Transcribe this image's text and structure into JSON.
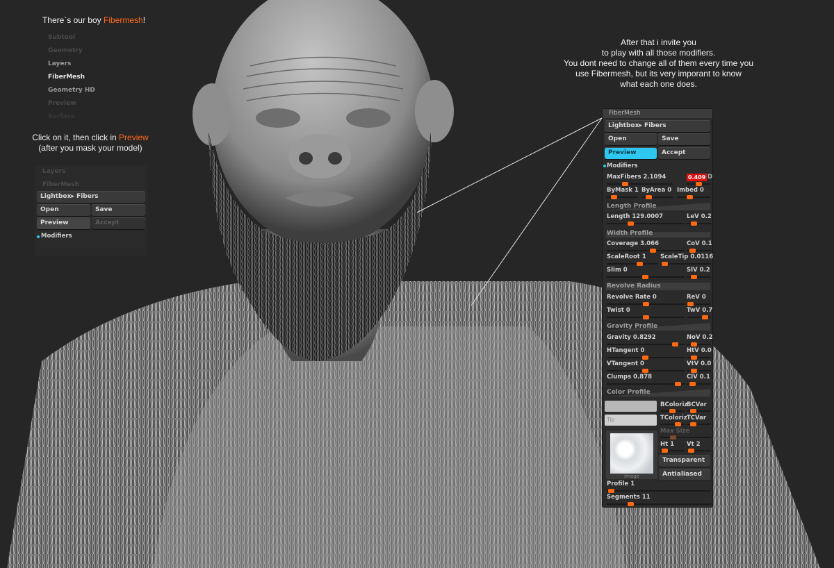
{
  "notes": {
    "top_prefix": "There`s our boy ",
    "top_accent": "Fibermesh",
    "top_suffix": "!",
    "click_prefix": "Click on it, then click in ",
    "click_accent": "Preview",
    "click_line2": "(after you mask your model)",
    "right_lines": [
      "After that i invite you",
      "to play with all those modifiers.",
      "You dont need to change all of them every time you",
      "use Fibermesh, but its very imporant to know",
      "what each one does."
    ]
  },
  "left_menu": [
    "Subtool",
    "Geometry",
    "Layers",
    "FiberMesh",
    "Geometry HD",
    "Preview",
    "Surface"
  ],
  "left_panel": {
    "dim_items": [
      "Layers",
      "FiberMesh"
    ],
    "lightbox": "Lightbox▸ Fibers",
    "open": "Open",
    "save": "Save",
    "preview": "Preview",
    "accept": "Accept",
    "modifiers": "Modifiers",
    "cut_off": "Modifiers"
  },
  "fibermesh": {
    "title": "FiberMesh",
    "lightbox": "Lightbox▸ Fibers",
    "open": "Open",
    "save": "Save",
    "preview": "Preview",
    "accept": "Accept",
    "modifiers": "Modifiers",
    "maxfibers_label": "MaxFibers",
    "maxfibers_value": "2.1094",
    "red_value": "0.409",
    "red_suffix": "D",
    "bymask": "ByMask 1",
    "byarea": "ByArea 0",
    "imbed": "Imbed 0",
    "length_profile": "Length Profile",
    "length": "Length 129.0007",
    "lev": "LeV 0.2",
    "width_profile": "Width Profile",
    "coverage": "Coverage 3.066",
    "cov": "CoV 0.1",
    "scaleroot": "ScaleRoot 1",
    "scaletip": "ScaleTip 0.0116",
    "slim": "Slim 0",
    "slv": "SlV 0.2",
    "revolve_radius": "Revolve Radius",
    "revolve_rate": "Revolve Rate 0",
    "rev": "ReV 0",
    "twist": "Twist 0",
    "twv": "TwV 0.7",
    "gravity_profile": "Gravity Profile",
    "gravity": "Gravity 0.8292",
    "nov": "NoV 0.2",
    "htangent": "HTangent 0",
    "htv": "HtV 0.0",
    "vtangent": "VTangent 0",
    "vtv": "VtV 0.0",
    "clumps": "Clumps 0.878",
    "clv": "ClV 0.1",
    "color_profile": "Color Profile",
    "bcoloriz": "BColoriz",
    "bcvar": "BCVar",
    "tip": "Tip",
    "tcoloriz": "TColoriz",
    "tcvar": "TCVar",
    "max_size": "Max Size",
    "ht": "Ht 1",
    "vt": "Vt 2",
    "transparent": "Transparent",
    "antialiased": "Antialiased",
    "image": "Image",
    "profile": "Profile 1",
    "segments": "Segments 11"
  },
  "colors": {
    "accent": "#ff6a1a",
    "preview_active": "#2ec7ef",
    "slider_knob": "#ff6a10",
    "alert": "#e01010"
  }
}
